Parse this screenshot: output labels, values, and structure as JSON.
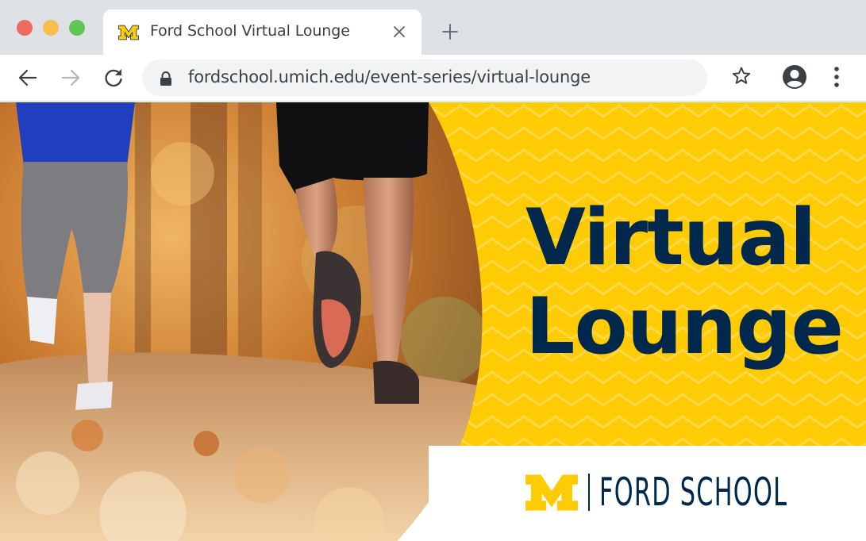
{
  "browser": {
    "tab": {
      "title": "Ford School Virtual Lounge",
      "favicon": "block-m-icon"
    },
    "url": "fordschool.umich.edu/event-series/virtual-lounge",
    "icons": {
      "back": "arrow-left-icon",
      "forward": "arrow-right-icon",
      "reload": "reload-icon",
      "lock": "lock-icon",
      "bookmark": "star-icon",
      "account": "account-icon",
      "menu": "kebab-menu-icon",
      "new_tab": "plus-icon",
      "close_tab": "close-icon"
    }
  },
  "banner": {
    "title_line1": "Virtual",
    "title_line2": "Lounge",
    "logo_text": "FORD SCHOOL",
    "colors": {
      "maize": "#ffcb05",
      "navy": "#00274c"
    }
  }
}
